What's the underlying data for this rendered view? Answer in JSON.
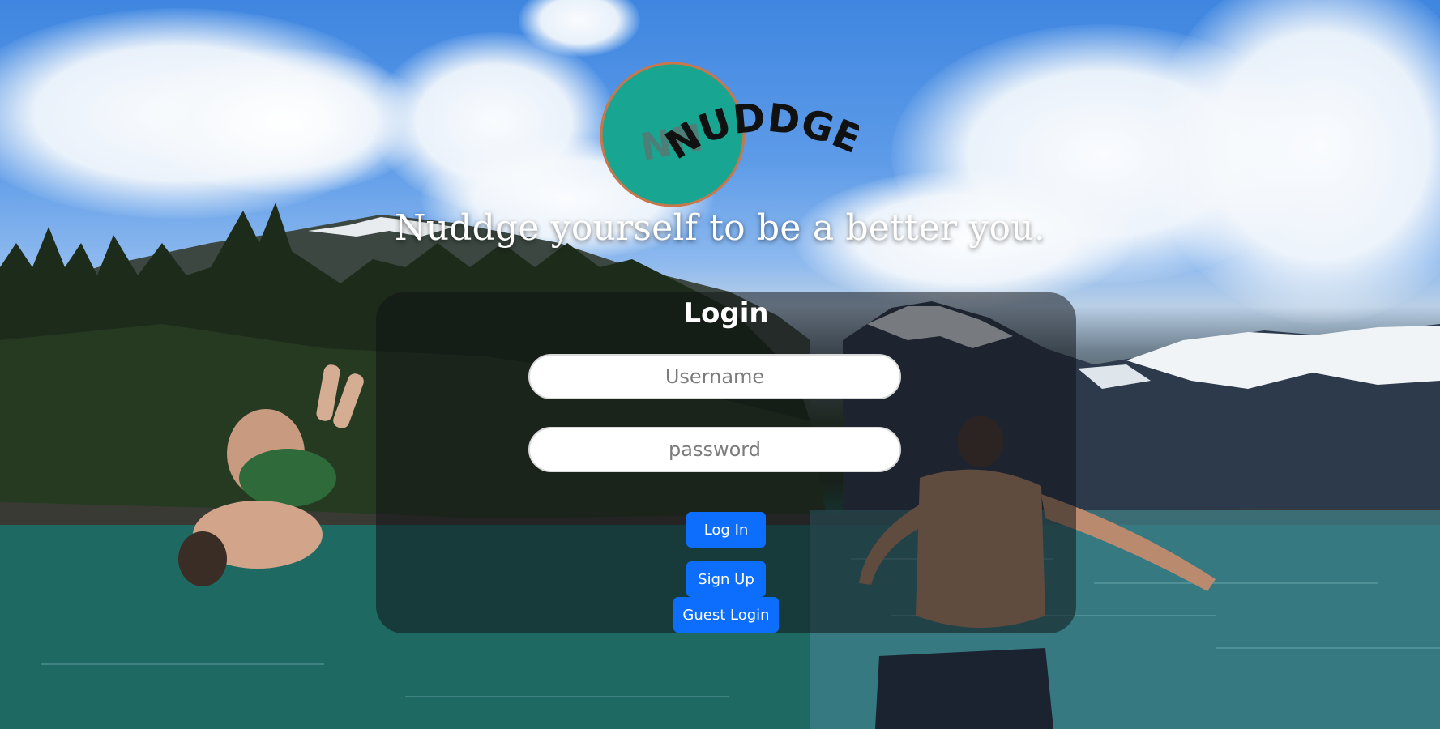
{
  "brand": {
    "logo_text": "NUDDGE",
    "logo_circle_color": "#18a692",
    "logo_border_color": "#c9774a"
  },
  "tagline": "Nuddge yourself to be a better you.",
  "login": {
    "title": "Login",
    "username_placeholder": "Username",
    "password_placeholder": "password",
    "login_button": "Log In",
    "signup_button": "Sign Up",
    "guest_button": "Guest Login"
  },
  "colors": {
    "primary_button": "#0d6efd",
    "card_overlay": "rgba(15,18,22,0.52)"
  }
}
